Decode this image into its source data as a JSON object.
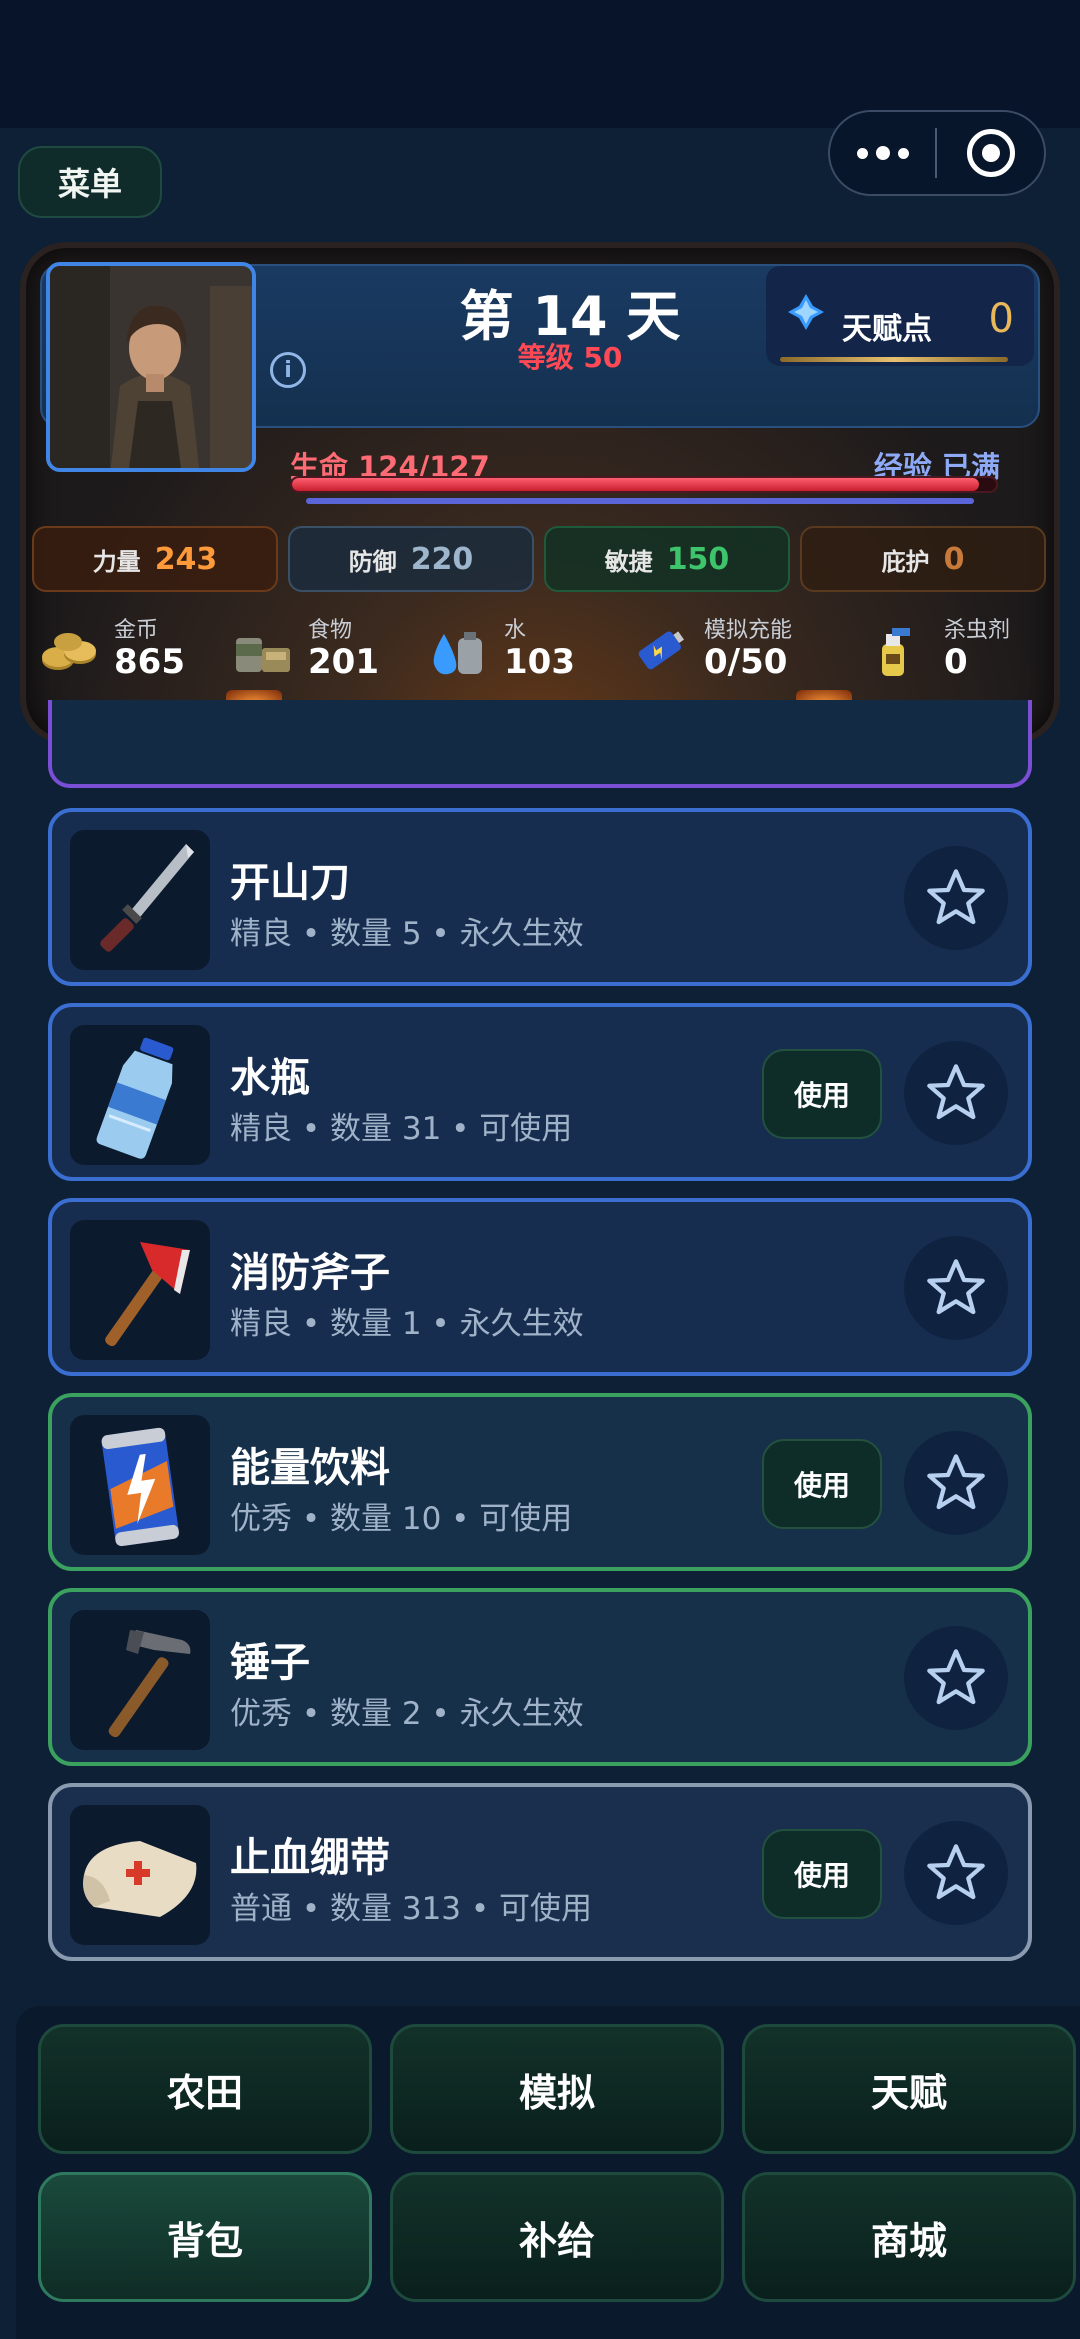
{
  "header": {
    "menu_label": "菜单"
  },
  "player": {
    "day_title": "第 14 天",
    "level_text": "等级 50",
    "talent_label": "天赋点",
    "talent_points": "0",
    "hp_text": "生命 124/127",
    "hp_fraction": 0.976,
    "exp_text": "经验 已满",
    "stats": [
      {
        "label": "力量",
        "value": "243"
      },
      {
        "label": "防御",
        "value": "220"
      },
      {
        "label": "敏捷",
        "value": "150"
      },
      {
        "label": "庇护",
        "value": "0"
      }
    ],
    "resources": [
      {
        "label": "金币",
        "value": "865",
        "icon": "coins-icon"
      },
      {
        "label": "食物",
        "value": "201",
        "icon": "food-icon"
      },
      {
        "label": "水",
        "value": "103",
        "icon": "water-icon"
      },
      {
        "label": "模拟充能",
        "value": "0/50",
        "icon": "battery-icon"
      },
      {
        "label": "杀虫剂",
        "value": "0",
        "icon": "spray-icon"
      }
    ]
  },
  "items": [
    {
      "name": "开山刀",
      "meta": "精良 • 数量 5 • 永久生效",
      "quality": "good",
      "icon": "machete-icon",
      "usable": false
    },
    {
      "name": "水瓶",
      "meta": "精良 • 数量 31 • 可使用",
      "quality": "good",
      "icon": "water-bottle-icon",
      "usable": true,
      "use_label": "使用"
    },
    {
      "name": "消防斧子",
      "meta": "精良 • 数量 1 • 永久生效",
      "quality": "good",
      "icon": "fire-axe-icon",
      "usable": false
    },
    {
      "name": "能量饮料",
      "meta": "优秀 • 数量 10 • 可使用",
      "quality": "excellent",
      "icon": "energy-drink-icon",
      "usable": true,
      "use_label": "使用"
    },
    {
      "name": "锤子",
      "meta": "优秀 • 数量 2 • 永久生效",
      "quality": "excellent",
      "icon": "hammer-icon",
      "usable": false
    },
    {
      "name": "止血绷带",
      "meta": "普通 • 数量 313 • 可使用",
      "quality": "normal",
      "icon": "bandage-icon",
      "usable": true,
      "use_label": "使用"
    }
  ],
  "nav": {
    "farm": "农田",
    "simulate": "模拟",
    "talent": "天赋",
    "bag": "背包",
    "supply": "补给",
    "shop": "商城"
  },
  "colors": {
    "background": "#0d2035",
    "hp": "#e0293a",
    "strength": "#ff9a3a",
    "agility": "#3ec46a",
    "quality_good": "#3a6ed0",
    "quality_excellent": "#3aa25e",
    "quality_normal": "#8a9bb0"
  }
}
